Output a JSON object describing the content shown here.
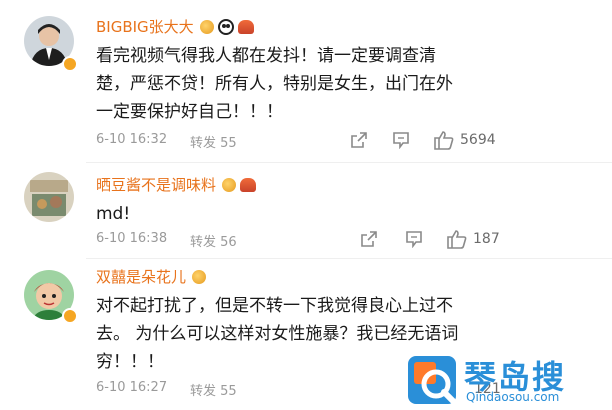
{
  "comments": [
    {
      "name": "BIGBIG张大大",
      "text_lines": [
        "看完视频气得我人都在发抖！请一定要调查清",
        "楚，严惩不贷！所有人，特别是女生，出门在外",
        "一定要保护好自己！！！"
      ],
      "time": "6-10 16:32",
      "repost": "转发 55",
      "likes": "5694"
    },
    {
      "name": "晒豆酱不是调味料",
      "text_lines": [
        "md!"
      ],
      "time": "6-10 16:38",
      "repost": "转发 56",
      "likes": "187"
    },
    {
      "name": "双囍是朵花儿",
      "text_lines": [
        "对不起打扰了，但是不转一下我觉得良心上过不",
        "去。 为什么可以这样对女性施暴？我已经无语词",
        "穷！！！"
      ],
      "time": "6-10 16:27",
      "repost": "转发 55",
      "likes": "121"
    }
  ],
  "watermark": {
    "brand": "琴岛搜",
    "url": "Qindaosou.com"
  },
  "colors": {
    "name": "#e8731c",
    "meta": "#9a9a9a",
    "text": "#1a1a1a",
    "vip": "#f5a623"
  }
}
